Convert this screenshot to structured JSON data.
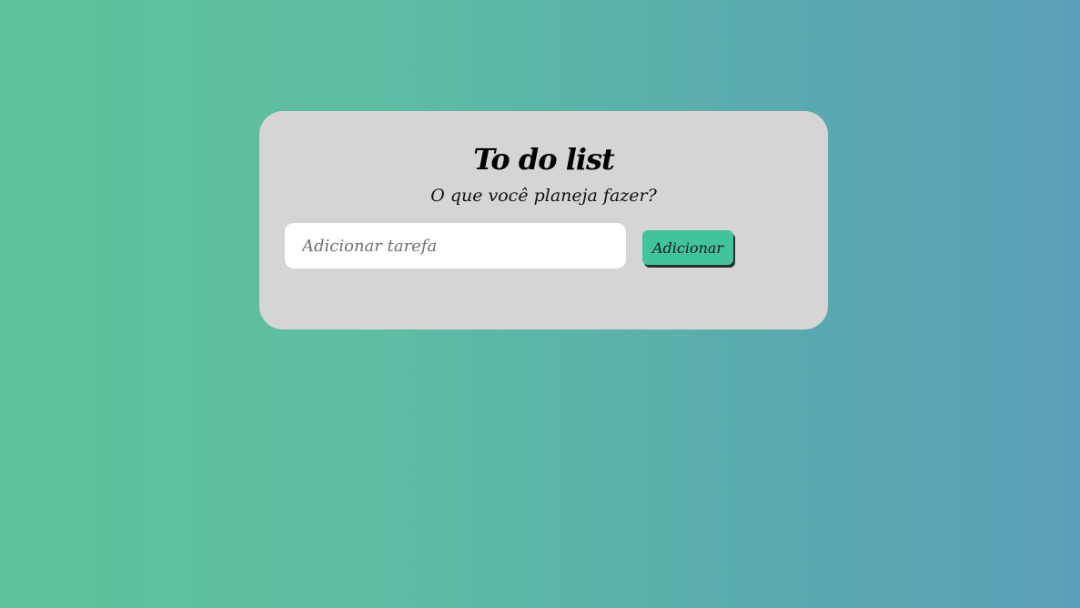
{
  "todo": {
    "title": "To do list",
    "subtitle": "O que você planeja fazer?",
    "input": {
      "placeholder": "Adicionar tarefa",
      "value": ""
    },
    "add_button_label": "Adicionar"
  },
  "colors": {
    "background_gradient_start": "#5dc29a",
    "background_gradient_end": "#5a9fb7",
    "card_background": "#d6d5d4",
    "button_background": "#41c49b",
    "input_background": "#ffffff"
  }
}
